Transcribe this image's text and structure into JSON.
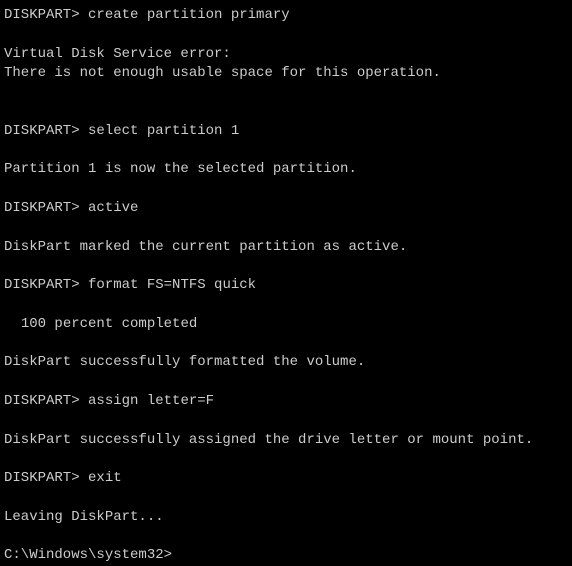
{
  "lines": [
    {
      "prompt": "DISKPART>",
      "command": "create partition primary"
    },
    {
      "blank": true
    },
    {
      "text": "Virtual Disk Service error:"
    },
    {
      "text": "There is not enough usable space for this operation."
    },
    {
      "blank": true
    },
    {
      "blank": true
    },
    {
      "prompt": "DISKPART>",
      "command": "select partition 1"
    },
    {
      "blank": true
    },
    {
      "text": "Partition 1 is now the selected partition."
    },
    {
      "blank": true
    },
    {
      "prompt": "DISKPART>",
      "command": "active"
    },
    {
      "blank": true
    },
    {
      "text": "DiskPart marked the current partition as active."
    },
    {
      "blank": true
    },
    {
      "prompt": "DISKPART>",
      "command": "format FS=NTFS quick"
    },
    {
      "blank": true
    },
    {
      "text": "  100 percent completed"
    },
    {
      "blank": true
    },
    {
      "text": "DiskPart successfully formatted the volume."
    },
    {
      "blank": true
    },
    {
      "prompt": "DISKPART>",
      "command": "assign letter=F"
    },
    {
      "blank": true
    },
    {
      "text": "DiskPart successfully assigned the drive letter or mount point."
    },
    {
      "blank": true
    },
    {
      "prompt": "DISKPART>",
      "command": "exit"
    },
    {
      "blank": true
    },
    {
      "text": "Leaving DiskPart..."
    },
    {
      "blank": true
    },
    {
      "prompt": "C:\\Windows\\system32>",
      "command": ""
    }
  ]
}
